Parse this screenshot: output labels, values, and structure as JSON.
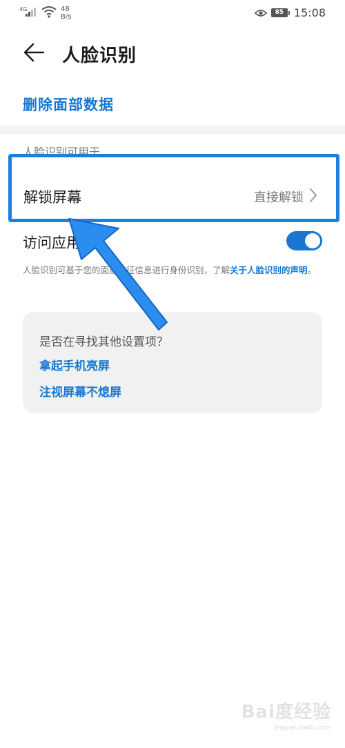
{
  "status_bar": {
    "network_type": "4G",
    "speed_value": "48",
    "speed_unit": "B/s",
    "battery_level": "85",
    "time": "15:08"
  },
  "header": {
    "title": "人脸识别"
  },
  "delete_action": {
    "label": "删除面部数据"
  },
  "usage_section": {
    "label": "人脸识别可用于"
  },
  "unlock_screen": {
    "label": "解锁屏幕",
    "value": "直接解锁"
  },
  "app_lock": {
    "label": "访问应用锁",
    "toggle_on": true
  },
  "description": {
    "text": "人脸识别可基于您的面部特征信息进行身份识别，了解",
    "link": "关于人脸识别的声明",
    "suffix": "。"
  },
  "suggestions": {
    "title": "是否在寻找其他设置项？",
    "items": [
      "拿起手机亮屏",
      "注视屏幕不熄屏"
    ]
  },
  "colors": {
    "accent": "#1878d4",
    "highlight": "#1c7fe3",
    "toggle": "#1976d2"
  },
  "watermark": {
    "logo": "Bai度经验",
    "url": "jingyan.baidu.com"
  }
}
